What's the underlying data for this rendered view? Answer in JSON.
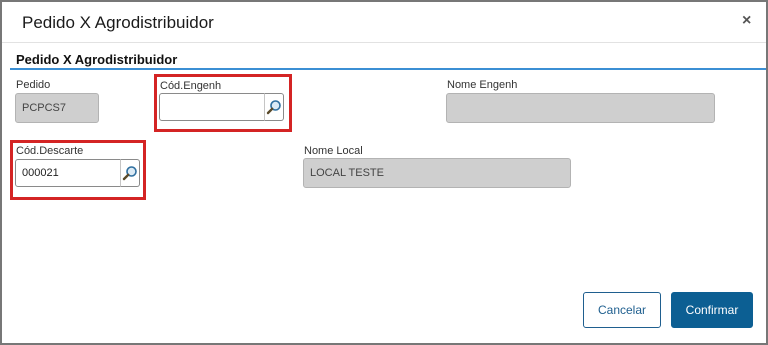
{
  "dialog": {
    "title": "Pedido X Agrodistribuidor",
    "close_symbol": "×",
    "section_title": "Pedido X Agrodistribuidor"
  },
  "fields": {
    "pedido": {
      "label": "Pedido",
      "value": "PCPCS7"
    },
    "cod_engenh": {
      "label": "Cód.Engenh",
      "value": ""
    },
    "nome_engenh": {
      "label": "Nome Engenh",
      "value": ""
    },
    "cod_descarte": {
      "label": "Cód.Descarte",
      "value": "000021"
    },
    "nome_local": {
      "label": "Nome Local",
      "value": "LOCAL TESTE"
    }
  },
  "buttons": {
    "cancel": "Cancelar",
    "confirm": "Confirmar"
  },
  "colors": {
    "highlight": "#d42424",
    "accent_rule": "#3b8fd4",
    "primary_button": "#0c5f93"
  },
  "icons": {
    "lookup": "magnifier-icon",
    "close": "close-icon"
  }
}
